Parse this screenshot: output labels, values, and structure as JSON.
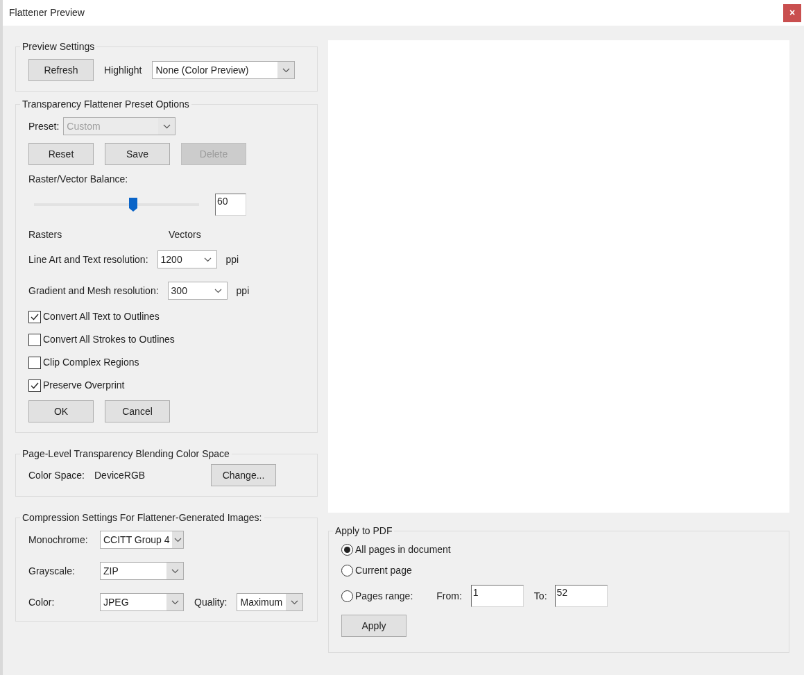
{
  "window": {
    "title": "Flattener Preview",
    "close_button": "×"
  },
  "preview_settings": {
    "title": "Preview Settings",
    "refresh_button": "Refresh",
    "highlight_label": "Highlight",
    "highlight_value": "None (Color Preview)"
  },
  "preset_options": {
    "title": "Transparency Flattener Preset Options",
    "preset_label": "Preset:",
    "preset_value": "Custom",
    "preset_disabled": true,
    "buttons": [
      {
        "label": "Reset",
        "disabled": false
      },
      {
        "label": "Save",
        "disabled": false
      },
      {
        "label": "Delete",
        "disabled": true
      }
    ],
    "balance_label": "Raster/Vector Balance:",
    "balance": {
      "level": 0.6,
      "value": "60"
    },
    "rasters_label": "Rasters",
    "vectors_label": "Vectors",
    "resolutions": [
      {
        "label": "Line Art and Text resolution:",
        "value": "1200",
        "unit": "ppi"
      },
      {
        "label": "Gradient and Mesh resolution:",
        "value": "300",
        "unit": "ppi"
      }
    ],
    "checkboxes": [
      {
        "label": "Convert All Text to Outlines",
        "checked": true
      },
      {
        "label": "Convert All Strokes to Outlines",
        "checked": false
      },
      {
        "label": "Clip Complex Regions",
        "checked": false
      },
      {
        "label": "Preserve Overprint",
        "checked": true
      }
    ],
    "ok_button": "OK",
    "cancel_button": "Cancel"
  },
  "blending": {
    "title": "Page-Level Transparency Blending Color Space",
    "label": "Color Space:",
    "value": "DeviceRGB",
    "change_button": "Change..."
  },
  "compression": {
    "title": "Compression Settings For Flattener-Generated Images:",
    "rows": [
      {
        "label": "Monochrome:",
        "value": "CCITT Group 4"
      },
      {
        "label": "Grayscale:",
        "value": "ZIP"
      },
      {
        "label": "Color:",
        "value": "JPEG",
        "quality": {
          "label": "Quality:",
          "value": "Maximum"
        }
      }
    ]
  },
  "apply": {
    "title": "Apply to PDF",
    "options": [
      {
        "label": "All pages in document",
        "selected": true
      },
      {
        "label": "Current page",
        "selected": false
      },
      {
        "label": "Pages range:",
        "selected": false,
        "range": {
          "from_label": "From:",
          "from_value": "1",
          "to_label": "To:",
          "to_value": "52"
        }
      }
    ],
    "apply_button": "Apply"
  }
}
